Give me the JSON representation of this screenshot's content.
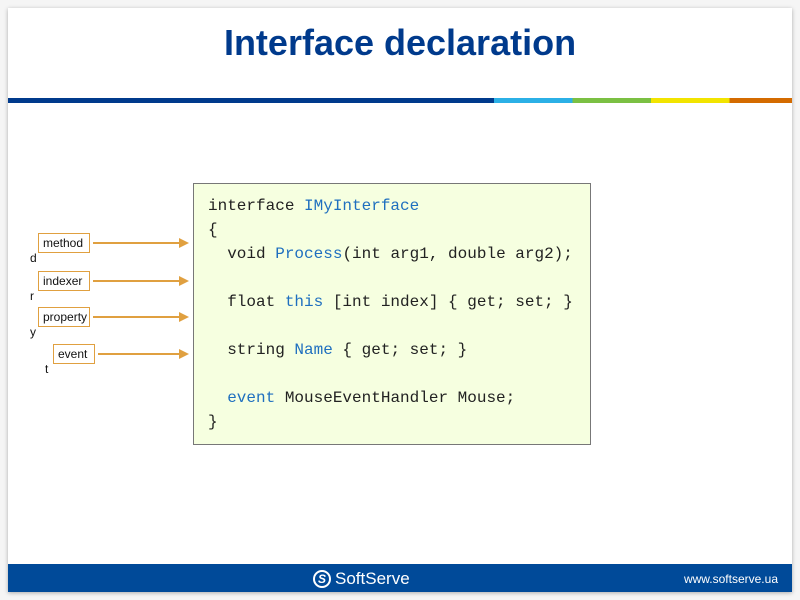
{
  "title": "Interface declaration",
  "labels": {
    "method": "method",
    "indexer": "indexer",
    "property": "property",
    "event": "event"
  },
  "code": {
    "l1_a": "interface ",
    "l1_b": "IMyInterface",
    "l2": "{",
    "l3_a": "  void ",
    "l3_b": "Process",
    "l3_c": "(int arg1, double arg2);",
    "l5_a": "  float ",
    "l5_b": "this",
    "l5_c": " [int index] { get; set; }",
    "l7_a": "  string ",
    "l7_b": "Name",
    "l7_c": " { get; set; }",
    "l9_a": "  ",
    "l9_b": "event",
    "l9_c": " MouseEventHandler Mouse;",
    "l10": "}"
  },
  "footer": {
    "brand": "SoftServe",
    "url": "www.softserve.ua"
  }
}
